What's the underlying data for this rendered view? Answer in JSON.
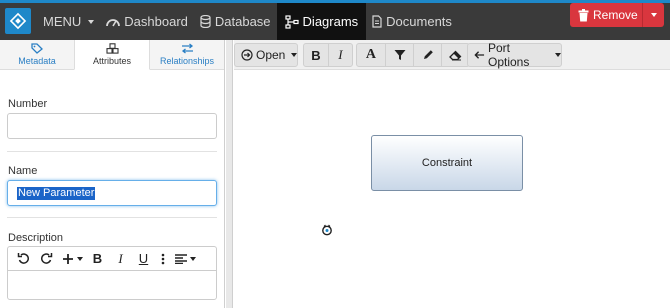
{
  "nav": {
    "menu_label": "MENU",
    "dashboard_label": "Dashboard",
    "database_label": "Database",
    "diagrams_label": "Diagrams",
    "documents_label": "Documents",
    "accent_color": "#1e88c9"
  },
  "left_panel": {
    "tabs": [
      {
        "label": "Metadata",
        "icon": "tag-icon"
      },
      {
        "label": "Attributes",
        "icon": "cubes-icon",
        "active": true
      },
      {
        "label": "Relationships",
        "icon": "exchange-icon"
      }
    ],
    "number": {
      "label": "Number",
      "value": ""
    },
    "name": {
      "label": "Name",
      "value": "New Parameter"
    },
    "description": {
      "label": "Description",
      "value": ""
    },
    "rte_buttons": [
      "undo-icon",
      "redo-icon",
      "plus-icon",
      "bold-icon",
      "italic-icon",
      "underline-icon",
      "more-icon",
      "align-icon"
    ]
  },
  "toolbar": {
    "open_label": "Open",
    "port_options_label": "Port Options",
    "remove_label": "Remove",
    "remove_color": "#d9363e"
  },
  "canvas": {
    "node_label": "Constraint"
  }
}
